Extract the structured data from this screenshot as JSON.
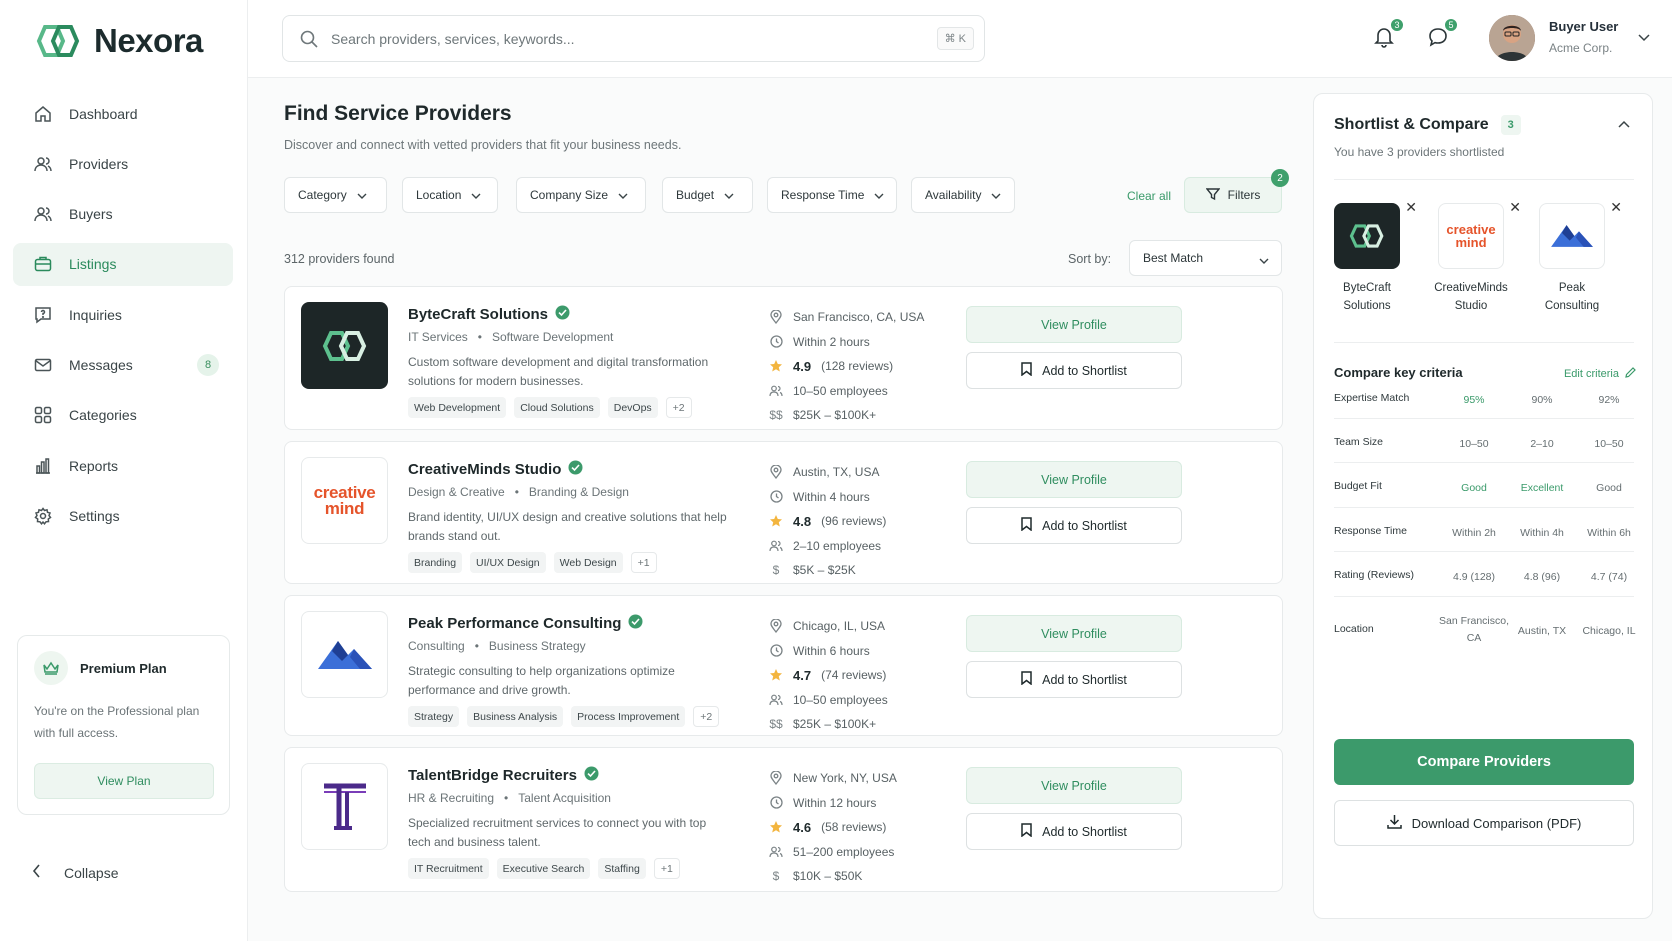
{
  "brand": {
    "name": "Nexora"
  },
  "nav": {
    "items": [
      {
        "label": "Dashboard",
        "icon": "home-icon"
      },
      {
        "label": "Providers",
        "icon": "users-icon"
      },
      {
        "label": "Buyers",
        "icon": "users-icon"
      },
      {
        "label": "Listings",
        "icon": "briefcase-icon",
        "active": true
      },
      {
        "label": "Inquiries",
        "icon": "chat-question-icon"
      },
      {
        "label": "Messages",
        "icon": "mail-icon",
        "badge": "8"
      },
      {
        "label": "Categories",
        "icon": "grid-icon"
      },
      {
        "label": "Reports",
        "icon": "bar-chart-icon"
      },
      {
        "label": "Settings",
        "icon": "gear-icon"
      }
    ]
  },
  "plan": {
    "title": "Premium Plan",
    "desc": "You're on the Professional plan with full access.",
    "button": "View Plan"
  },
  "collapse": "Collapse",
  "search": {
    "placeholder": "Search providers, services, keywords...",
    "shortcut": "⌘ K"
  },
  "topbar": {
    "notifications": "3",
    "messages": "5",
    "user_name": "Buyer User",
    "user_org": "Acme Corp."
  },
  "page": {
    "title": "Find Service Providers",
    "subtitle": "Discover and connect with vetted providers that fit your business needs."
  },
  "filters": {
    "items": [
      "Category",
      "Location",
      "Company Size",
      "Budget",
      "Response Time",
      "Availability"
    ],
    "clear": "Clear all",
    "button": "Filters",
    "count": "2"
  },
  "results": {
    "found": "312 providers found",
    "sort_label": "Sort by:",
    "sort_value": "Best Match"
  },
  "providers": [
    {
      "name": "ByteCraft Solutions",
      "cat1": "IT Services",
      "cat2": "Software Development",
      "desc": "Custom software development and digital transformation solutions for modern businesses.",
      "tags": [
        "Web Development",
        "Cloud Solutions",
        "DevOps",
        "+2"
      ],
      "location": "San Francisco, CA, USA",
      "response": "Within 2 hours",
      "rating": "4.9",
      "reviews": "(128 reviews)",
      "employees": "10–50 employees",
      "price_symbol": "$$",
      "budget": "$25K – $100K+",
      "view": "View Profile",
      "shortlist": "Add to Shortlist"
    },
    {
      "name": "CreativeMinds Studio",
      "cat1": "Design & Creative",
      "cat2": "Branding & Design",
      "desc": "Brand identity, UI/UX design and creative solutions that help brands stand out.",
      "tags": [
        "Branding",
        "UI/UX Design",
        "Web Design",
        "+1"
      ],
      "location": "Austin, TX, USA",
      "response": "Within 4 hours",
      "rating": "4.8",
      "reviews": "(96 reviews)",
      "employees": "2–10 employees",
      "price_symbol": "$",
      "budget": "$5K – $25K",
      "view": "View Profile",
      "shortlist": "Add to Shortlist",
      "logo_text": "creative mind"
    },
    {
      "name": "Peak Performance Consulting",
      "cat1": "Consulting",
      "cat2": "Business Strategy",
      "desc": "Strategic consulting to help organizations optimize performance and drive growth.",
      "tags": [
        "Strategy",
        "Business Analysis",
        "Process Improvement",
        "+2"
      ],
      "location": "Chicago, IL, USA",
      "response": "Within 6 hours",
      "rating": "4.7",
      "reviews": "(74 reviews)",
      "employees": "10–50 employees",
      "price_symbol": "$$",
      "budget": "$25K – $100K+",
      "view": "View Profile",
      "shortlist": "Add to Shortlist"
    },
    {
      "name": "TalentBridge Recruiters",
      "cat1": "HR & Recruiting",
      "cat2": "Talent Acquisition",
      "desc": "Specialized recruitment services to connect you with top tech and business talent.",
      "tags": [
        "IT Recruitment",
        "Executive Search",
        "Staffing",
        "+1"
      ],
      "location": "New York, NY, USA",
      "response": "Within 12 hours",
      "rating": "4.6",
      "reviews": "(58 reviews)",
      "employees": "51–200 employees",
      "price_symbol": "$",
      "budget": "$10K – $50K",
      "view": "View Profile",
      "shortlist": "Add to Shortlist"
    }
  ],
  "panel": {
    "title": "Shortlist & Compare",
    "count": "3",
    "subtitle": "You have 3 providers shortlisted",
    "shortlist": [
      {
        "name1": "ByteCraft",
        "name2": "Solutions"
      },
      {
        "name1": "CreativeMinds",
        "name2": "Studio"
      },
      {
        "name1": "Peak",
        "name2": "Consulting"
      }
    ],
    "criteria_title": "Compare key criteria",
    "edit": "Edit criteria",
    "criteria": [
      {
        "label": "Expertise Match",
        "values": [
          "95%",
          "90%",
          "92%"
        ]
      },
      {
        "label": "Team Size",
        "values": [
          "10–50",
          "2–10",
          "10–50"
        ]
      },
      {
        "label": "Budget Fit",
        "values": [
          "Good",
          "Excellent",
          "Good"
        ]
      },
      {
        "label": "Response Time",
        "values": [
          "Within 2h",
          "Within 4h",
          "Within 6h"
        ]
      },
      {
        "label": "Rating (Reviews)",
        "values": [
          "4.9 (128)",
          "4.8 (96)",
          "4.7 (74)"
        ]
      },
      {
        "label": "Location",
        "values": [
          "San Francisco, CA",
          "Austin, TX",
          "Chicago, IL"
        ]
      }
    ],
    "compare_btn": "Compare Providers",
    "download_btn": "Download Comparison (PDF)"
  },
  "colors": {
    "accent": "#3c9a6b",
    "accent_light": "#eef6f1",
    "dark_logo": "#1d2627",
    "creative_red": "#e5542b",
    "peak_blue": "#3b6fd8",
    "talent_purple": "#4b2a8a"
  }
}
